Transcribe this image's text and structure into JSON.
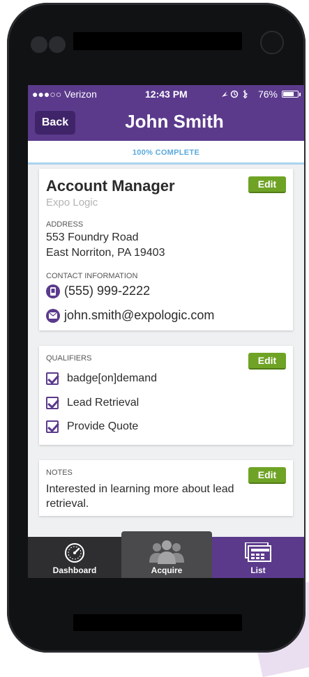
{
  "status_bar": {
    "carrier": "●●●○○ Verizon",
    "time": "12:43 PM",
    "battery": "76%",
    "battery_level": 0.76
  },
  "nav": {
    "back_label": "Back",
    "title": "John Smith"
  },
  "progress": {
    "label": "100% COMPLETE",
    "value": 1.0
  },
  "contact_card": {
    "title": "Account Manager",
    "company": "Expo Logic",
    "edit_label": "Edit",
    "address_label": "ADDRESS",
    "address_line1": "553 Foundry Road",
    "address_line2": "East Norriton, PA 19403",
    "contact_label": "CONTACT INFORMATION",
    "phone": "(555) 999-2222",
    "email": "john.smith@expologic.com"
  },
  "qualifiers_card": {
    "label": "QUALIFIERS",
    "edit_label": "Edit",
    "items": [
      "badge[on]demand",
      "Lead Retrieval",
      "Provide Quote"
    ]
  },
  "notes_card": {
    "label": "NOTES",
    "edit_label": "Edit",
    "text": "Interested in learning more about lead retrieval."
  },
  "tabs": [
    {
      "label": "Dashboard",
      "icon": "dashboard-gauge-icon"
    },
    {
      "label": "Acquire",
      "icon": "people-group-icon"
    },
    {
      "label": "List",
      "icon": "list-cards-icon"
    }
  ],
  "colors": {
    "brand_purple": "#5b3a8c",
    "edit_green": "#6fa325",
    "progress_blue": "#5aa9dd"
  }
}
